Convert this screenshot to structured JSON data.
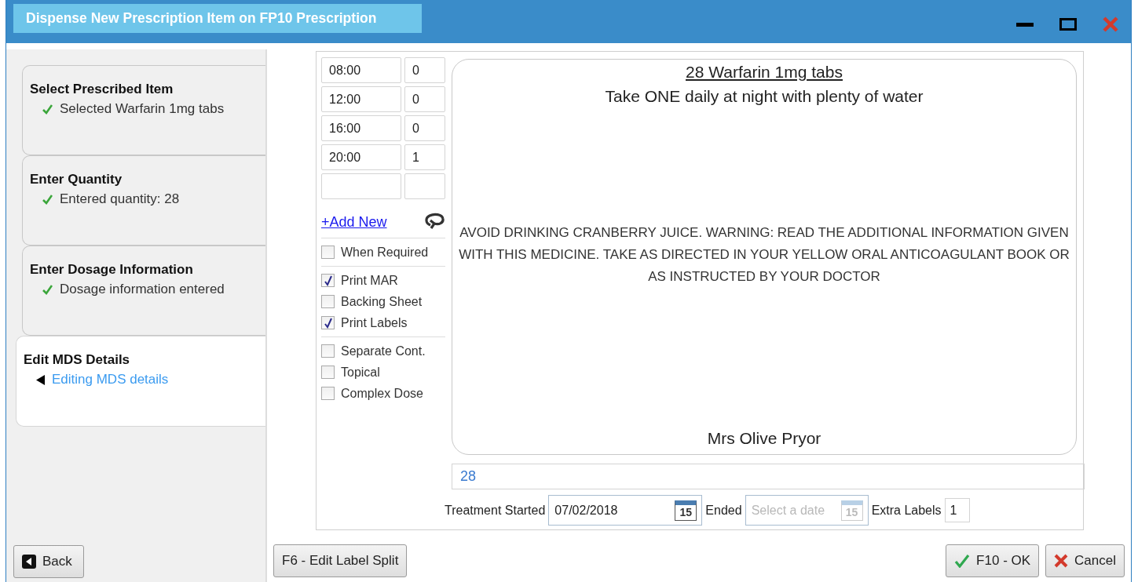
{
  "window": {
    "title": "Dispense New Prescription Item on FP10 Prescription"
  },
  "steps": [
    {
      "title": "Select Prescribed Item",
      "status": "Selected Warfarin 1mg tabs",
      "done": true,
      "selected": false
    },
    {
      "title": "Enter Quantity",
      "status": "Entered quantity: 28",
      "done": true,
      "selected": false
    },
    {
      "title": "Enter Dosage Information",
      "status": "Dosage information entered",
      "done": true,
      "selected": false
    },
    {
      "title": "Edit MDS Details",
      "status": "Editing MDS details",
      "done": false,
      "selected": true
    }
  ],
  "dose_times": [
    {
      "time": "08:00",
      "dose": "0"
    },
    {
      "time": "12:00",
      "dose": "0"
    },
    {
      "time": "16:00",
      "dose": "0"
    },
    {
      "time": "20:00",
      "dose": "1"
    }
  ],
  "add_new_link": "+Add New",
  "option_groups": [
    [
      {
        "label": "When Required",
        "checked": false
      }
    ],
    [
      {
        "label": "Print MAR",
        "checked": true
      },
      {
        "label": "Backing Sheet",
        "checked": false
      },
      {
        "label": "Print Labels",
        "checked": true
      }
    ],
    [
      {
        "label": "Separate Cont.",
        "checked": false
      },
      {
        "label": "Topical",
        "checked": false
      },
      {
        "label": "Complex Dose",
        "checked": false
      }
    ]
  ],
  "label_preview": {
    "title": "28 Warfarin 1mg tabs",
    "directions": "Take ONE daily at night with plenty of water",
    "warning": "AVOID DRINKING CRANBERRY JUICE. WARNING: READ THE ADDITIONAL INFORMATION GIVEN WITH THIS MEDICINE. TAKE AS DIRECTED IN YOUR YELLOW ORAL ANTICOAGULANT BOOK OR AS INSTRUCTED BY YOUR DOCTOR",
    "patient": "Mrs Olive Pryor"
  },
  "quantity": "28",
  "treatment": {
    "started_label": "Treatment Started",
    "started_value": "07/02/2018",
    "calendar_day": "15",
    "ended_label": "Ended",
    "ended_placeholder": "Select a date",
    "ended_calendar_day": "15",
    "extra_labels_label": "Extra Labels",
    "extra_labels_value": "1"
  },
  "buttons": {
    "back": "Back",
    "edit_label_split": "F6 - Edit Label Split",
    "ok": "F10 - OK",
    "cancel": "Cancel"
  }
}
